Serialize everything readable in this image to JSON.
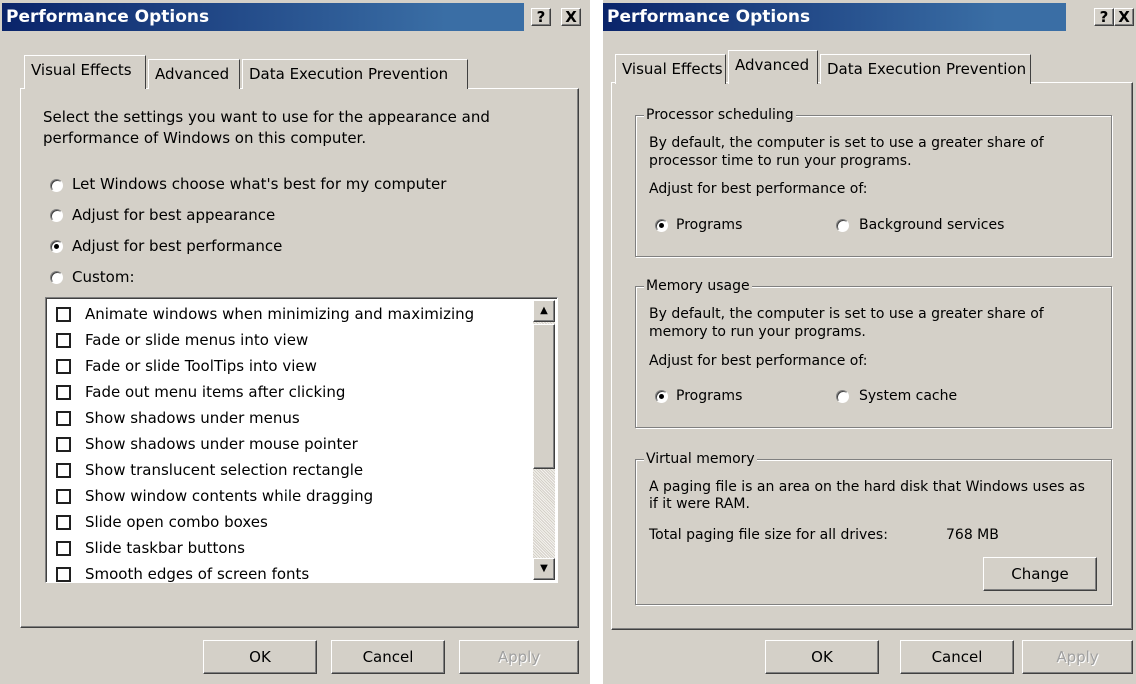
{
  "left_dialog": {
    "title": "Performance Options",
    "help_button": "?",
    "close_button": "X",
    "tabs": [
      "Visual Effects",
      "Advanced",
      "Data Execution Prevention"
    ],
    "active_tab": "Visual Effects",
    "description_line1": "Select the settings you want to use for the appearance and",
    "description_line2": "performance of Windows on this computer.",
    "options": [
      {
        "label": "Let Windows choose what's best for my computer",
        "selected": false
      },
      {
        "label": "Adjust for best appearance",
        "selected": false
      },
      {
        "label": "Adjust for best performance",
        "selected": true
      },
      {
        "label": "Custom:",
        "selected": false
      }
    ],
    "effects": [
      "Animate windows when minimizing and maximizing",
      "Fade or slide menus into view",
      "Fade or slide ToolTips into view",
      "Fade out menu items after clicking",
      "Show shadows under menus",
      "Show shadows under mouse pointer",
      "Show translucent selection rectangle",
      "Show window contents while dragging",
      "Slide open combo boxes",
      "Slide taskbar buttons",
      "Smooth edges of screen fonts"
    ],
    "buttons": {
      "ok": "OK",
      "cancel": "Cancel",
      "apply": "Apply"
    }
  },
  "right_dialog": {
    "title": "Performance Options",
    "help_button": "?",
    "close_button": "X",
    "tabs": [
      "Visual Effects",
      "Advanced",
      "Data Execution Prevention"
    ],
    "active_tab": "Advanced",
    "processor": {
      "legend": "Processor scheduling",
      "line1": "By default, the computer is set to use a greater share of",
      "line2": "processor time to run your programs.",
      "adjust_label": "Adjust for best performance of:",
      "option1": "Programs",
      "option2": "Background services",
      "selected": "Programs"
    },
    "memory": {
      "legend": "Memory usage",
      "line1": "By default, the computer is set to use a greater share of",
      "line2": "memory to run your programs.",
      "adjust_label": "Adjust for best performance of:",
      "option1": "Programs",
      "option2": "System cache",
      "selected": "Programs"
    },
    "virtual": {
      "legend": "Virtual memory",
      "line1": "A paging file is an area on the hard disk that Windows uses as",
      "line2": "if it were RAM.",
      "total_label": "Total paging file size for all drives:",
      "total_value": "768 MB",
      "change_button": "Change"
    },
    "buttons": {
      "ok": "OK",
      "cancel": "Cancel",
      "apply": "Apply"
    }
  }
}
